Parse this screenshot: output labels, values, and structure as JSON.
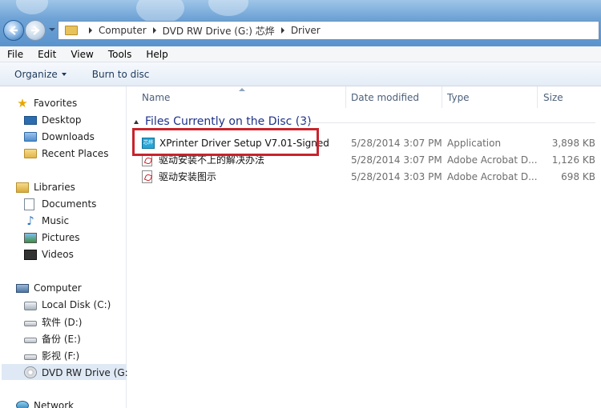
{
  "address": {
    "crumbs": [
      "Computer",
      "DVD RW Drive (G:) 芯烨",
      "Driver"
    ]
  },
  "menu": [
    "File",
    "Edit",
    "View",
    "Tools",
    "Help"
  ],
  "commands": {
    "organize": "Organize",
    "burn": "Burn to disc"
  },
  "navigation": {
    "favorites": {
      "label": "Favorites",
      "items": [
        "Desktop",
        "Downloads",
        "Recent Places"
      ]
    },
    "libraries": {
      "label": "Libraries",
      "items": [
        "Documents",
        "Music",
        "Pictures",
        "Videos"
      ]
    },
    "computer": {
      "label": "Computer",
      "items": [
        "Local Disk (C:)",
        "软件 (D:)",
        "备份 (E:)",
        "影视 (F:)",
        "DVD RW Drive (G:) 芯"
      ]
    },
    "network": {
      "label": "Network"
    }
  },
  "columns": {
    "name": "Name",
    "date": "Date modified",
    "type": "Type",
    "size": "Size"
  },
  "group": {
    "title": "Files Currently on the Disc (3)"
  },
  "files": [
    {
      "name": "XPrinter Driver Setup V7.01-Signed",
      "date": "5/28/2014 3:07 PM",
      "type": "Application",
      "size": "3,898 KB",
      "icon_text": "芯烨"
    },
    {
      "name": "驱动安装不上的解决办法",
      "date": "5/28/2014 3:07 PM",
      "type": "Adobe Acrobat D...",
      "size": "1,126 KB"
    },
    {
      "name": "驱动安装图示",
      "date": "5/28/2014 3:03 PM",
      "type": "Adobe Acrobat D...",
      "size": "698 KB"
    }
  ],
  "colors": {
    "highlight": "#c8232c",
    "group_text": "#1e3287",
    "command_text": "#1e395b"
  }
}
